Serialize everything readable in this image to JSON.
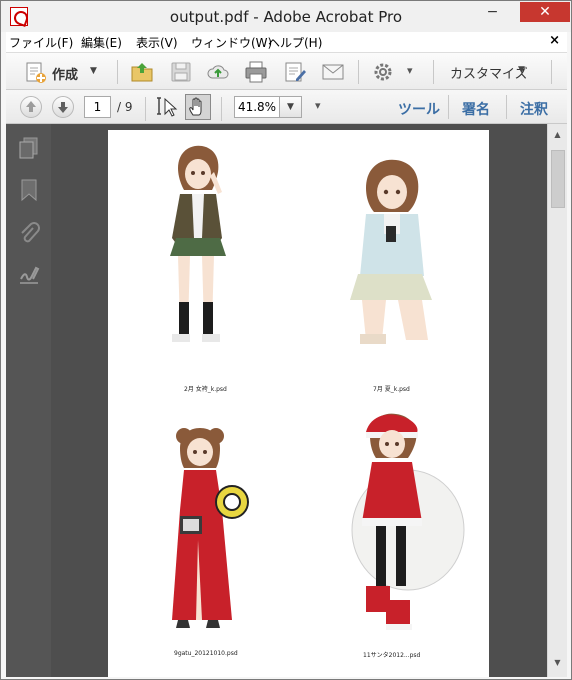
{
  "window": {
    "title": "output.pdf - Adobe Acrobat Pro",
    "min_glyph": "−",
    "max_glyph": "□",
    "close_glyph": "✕"
  },
  "menu": {
    "items": [
      "ファイル(F)",
      "編集(E)",
      "表示(V)",
      "ウィンドウ(W)",
      "ヘルプ(H)"
    ],
    "close_glyph": "×"
  },
  "toolbar": {
    "create_label": "作成",
    "create_caret": "▼",
    "customize_label": "カスタマイズ",
    "customize_caret": "▼",
    "more_caret": "▾"
  },
  "nav_toolbar": {
    "current_page": "1",
    "page_total": "/ 9",
    "zoom_value": "41.8%",
    "zoom_caret": "▼",
    "more_caret": "▾",
    "tools_link": "ツール",
    "sign_link": "署名",
    "comment_link": "注釈"
  },
  "document": {
    "thumbnails": [
      {
        "caption": "2月 女袴_k.psd",
        "outfit": "school-uniform"
      },
      {
        "caption": "7月 夏_k.psd",
        "outfit": "summer-kneeling"
      },
      {
        "caption": "9gatu_20121010.psd",
        "outfit": "red-china-dress"
      },
      {
        "caption": "11サンタ2012...psd",
        "outfit": "santa-with-sack"
      }
    ]
  },
  "scrollbar": {
    "up_glyph": "▲",
    "down_glyph": "▼"
  }
}
